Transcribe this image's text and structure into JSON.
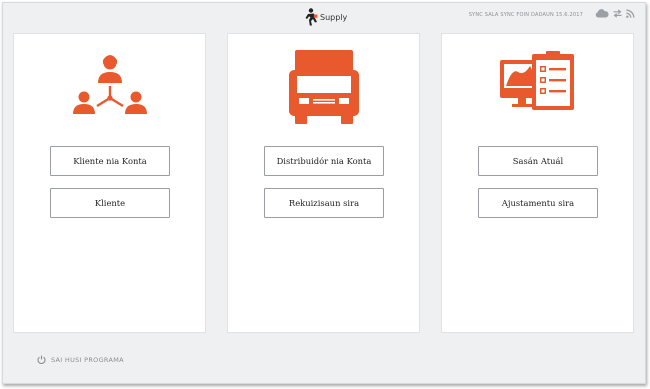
{
  "header": {
    "app_name": "Supply",
    "sync_status": "SYNC SALA  SYNC FOIN DADAUN 15.6.2017",
    "icons": [
      "cloud-icon",
      "sync-arrows-icon",
      "rss-icon"
    ]
  },
  "colors": {
    "accent": "#e8592d",
    "background": "#eff0f2"
  },
  "panels": [
    {
      "icon": "people-network-icon",
      "buttons": [
        "Kliente nia Konta",
        "Kliente"
      ]
    },
    {
      "icon": "truck-icon",
      "buttons": [
        "Distribuidór nia Konta",
        "Rekuizisaun sira"
      ]
    },
    {
      "icon": "computer-clipboard-icon",
      "buttons": [
        "Sasán Atuál",
        "Ajustamentu sira"
      ]
    }
  ],
  "footer": {
    "exit_label": "SAI HUSI PROGRAMA"
  }
}
